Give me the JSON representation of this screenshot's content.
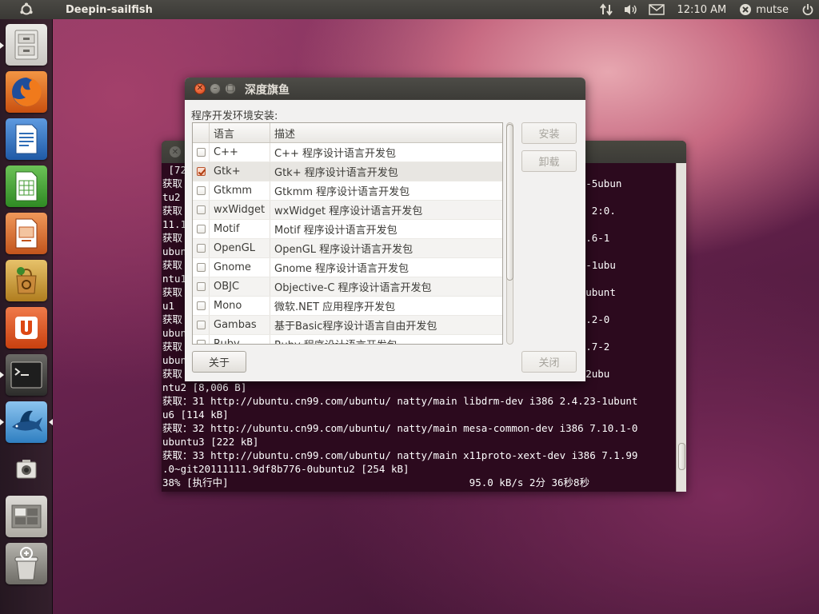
{
  "top_panel": {
    "app_title": "Deepin-sailfish",
    "clock": "12:10 AM",
    "user": "mutse"
  },
  "launcher": {
    "items": [
      {
        "name": "file-manager-icon",
        "color": "#d9d7d2"
      },
      {
        "name": "firefox-icon",
        "color": "#e8741e"
      },
      {
        "name": "writer-icon",
        "color": "#2f6db6"
      },
      {
        "name": "calc-icon",
        "color": "#3f9a2f"
      },
      {
        "name": "impress-icon",
        "color": "#d96a2a"
      },
      {
        "name": "software-center-icon",
        "color": "#c98f2a"
      },
      {
        "name": "ubuntu-one-icon",
        "color": "#dd4814"
      },
      {
        "name": "terminal-icon",
        "color": "#2f2f2f"
      },
      {
        "name": "sailfish-icon",
        "color": "#2f7fc1"
      },
      {
        "name": "screenshot-icon",
        "color": "#cfcdc8"
      },
      {
        "name": "workspaces-icon",
        "color": "#bdbab3"
      },
      {
        "name": "trash-icon",
        "color": "#9a9892"
      }
    ]
  },
  "terminal": {
    "lines": [
      " [72",
      "获取                                                            2:1.4.1-5ubun",
      "tu2 ",
      "获取                                                          -dev i386 2:0.",
      "11.1",
      "获取                                                         i386 1:0.9.6-1",
      "ubun",
      "获取                                                          86 1.2.44-1ubu",
      "ntu1",
      "获取                                                          2:1.2.0-1ubunt",
      "u1  ",
      "获取                                                          i386 0.20.2-0",
      "ubun",
      "获取                                                         dev i386 1.7-2",
      "ubun",
      "获取                                                          i386 1.7-2ubu",
      "ntu2 [8,006 B]",
      "获取：31 http://ubuntu.cn99.com/ubuntu/ natty/main libdrm-dev i386 2.4.23-1ubunt",
      "u6 [114 kB]",
      "获取：32 http://ubuntu.cn99.com/ubuntu/ natty/main mesa-common-dev i386 7.10.1-0",
      "ubuntu3 [222 kB]",
      "获取：33 http://ubuntu.cn99.com/ubuntu/ natty/main x11proto-xext-dev i386 7.1.99",
      ".0~git20111111.9df8b776-0ubuntu2 [254 kB]",
      "38% [执行中]                                        95.0 kB/s 2分 36秒8秒"
    ]
  },
  "dialog": {
    "title": "深度旗鱼",
    "section_label": "程序开发环境安装:",
    "columns": {
      "lang": "语言",
      "desc": "描述"
    },
    "rows": [
      {
        "lang": "C++",
        "desc": "C++ 程序设计语言开发包",
        "checked": false
      },
      {
        "lang": "Gtk+",
        "desc": "Gtk+ 程序设计语言开发包",
        "checked": true
      },
      {
        "lang": "Gtkmm",
        "desc": "Gtkmm 程序设计语言开发包",
        "checked": false
      },
      {
        "lang": "wxWidget",
        "desc": "wxWidget 程序设计语言开发包",
        "checked": false
      },
      {
        "lang": "Motif",
        "desc": "Motif 程序设计语言开发包",
        "checked": false
      },
      {
        "lang": "OpenGL",
        "desc": "OpenGL 程序设计语言开发包",
        "checked": false
      },
      {
        "lang": "Gnome",
        "desc": "Gnome 程序设计语言开发包",
        "checked": false
      },
      {
        "lang": "OBJC",
        "desc": "Objective-C 程序设计语言开发包",
        "checked": false
      },
      {
        "lang": "Mono",
        "desc": "微软.NET 应用程序开发包",
        "checked": false
      },
      {
        "lang": "Gambas",
        "desc": "基于Basic程序设计语言自由开发包",
        "checked": false
      },
      {
        "lang": "Ruby",
        "desc": "Ruby 程序设计语言开发包",
        "checked": false
      }
    ],
    "buttons": {
      "install": "安装",
      "uninstall": "卸载",
      "about": "关于",
      "close": "关闭"
    }
  }
}
